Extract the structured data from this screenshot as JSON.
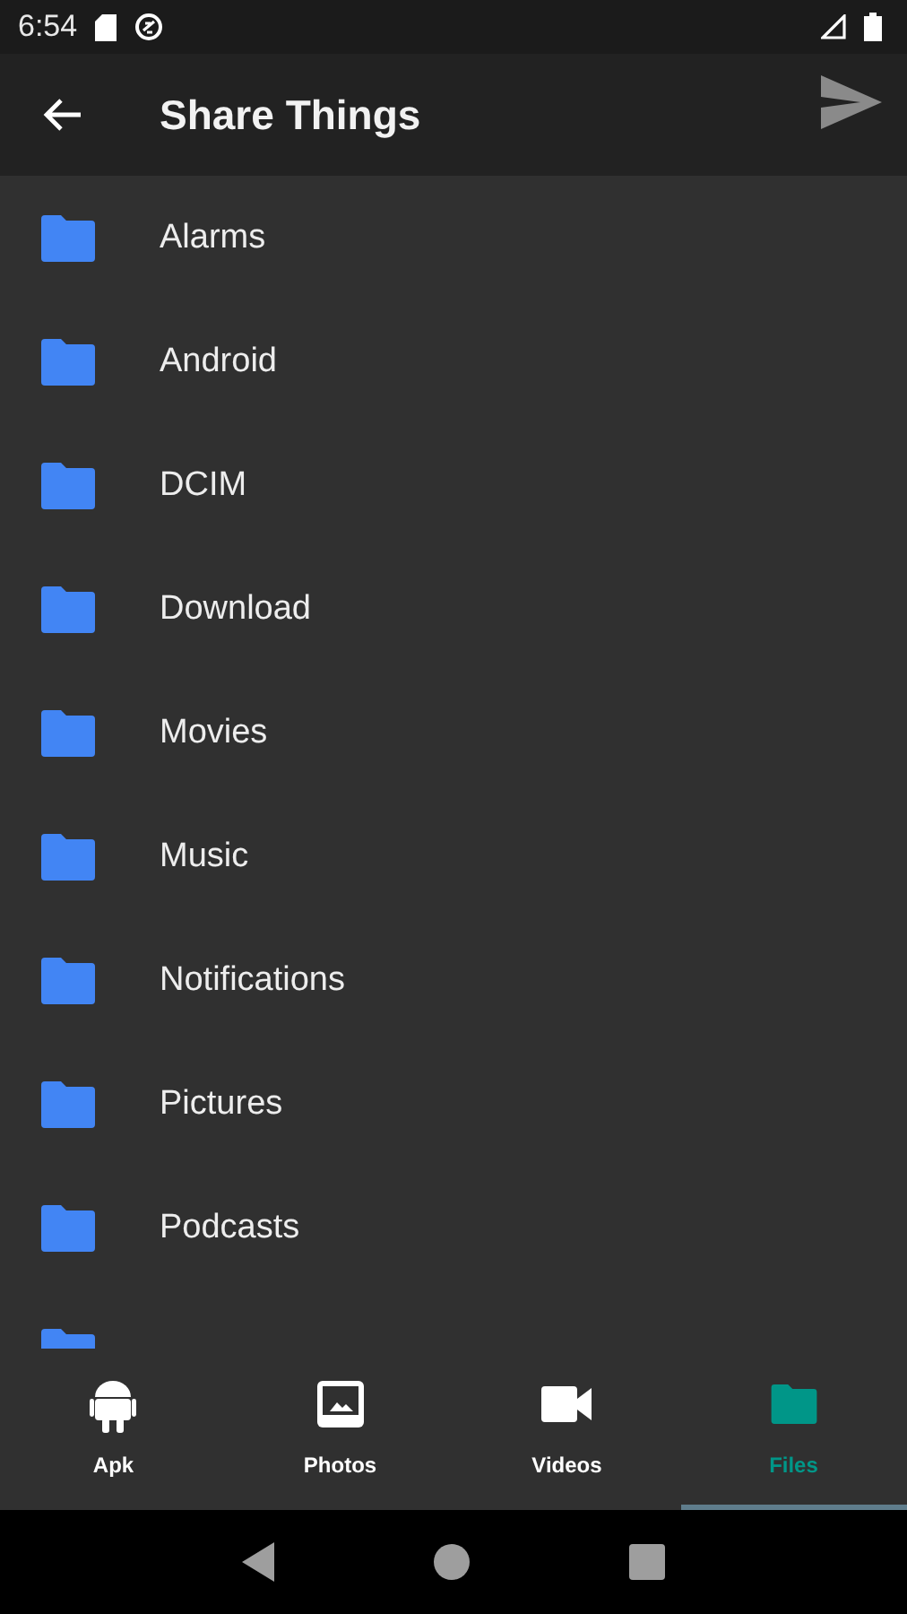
{
  "status_bar": {
    "time": "6:54"
  },
  "app_bar": {
    "title": "Share Things"
  },
  "folders": [
    {
      "kind": "folder",
      "name": "Alarms"
    },
    {
      "kind": "folder",
      "name": "Android"
    },
    {
      "kind": "folder",
      "name": "DCIM"
    },
    {
      "kind": "folder",
      "name": "Download"
    },
    {
      "kind": "folder",
      "name": "Movies"
    },
    {
      "kind": "folder",
      "name": "Music"
    },
    {
      "kind": "folder",
      "name": "Notifications"
    },
    {
      "kind": "folder",
      "name": "Pictures"
    },
    {
      "kind": "folder",
      "name": "Podcasts"
    },
    {
      "kind": "partial"
    }
  ],
  "tabs": [
    {
      "label": "Apk",
      "kind": "android",
      "selected": false
    },
    {
      "label": "Photos",
      "kind": "photo",
      "selected": false
    },
    {
      "label": "Videos",
      "kind": "video",
      "selected": false
    },
    {
      "label": "Files",
      "kind": "folder",
      "selected": true
    }
  ]
}
